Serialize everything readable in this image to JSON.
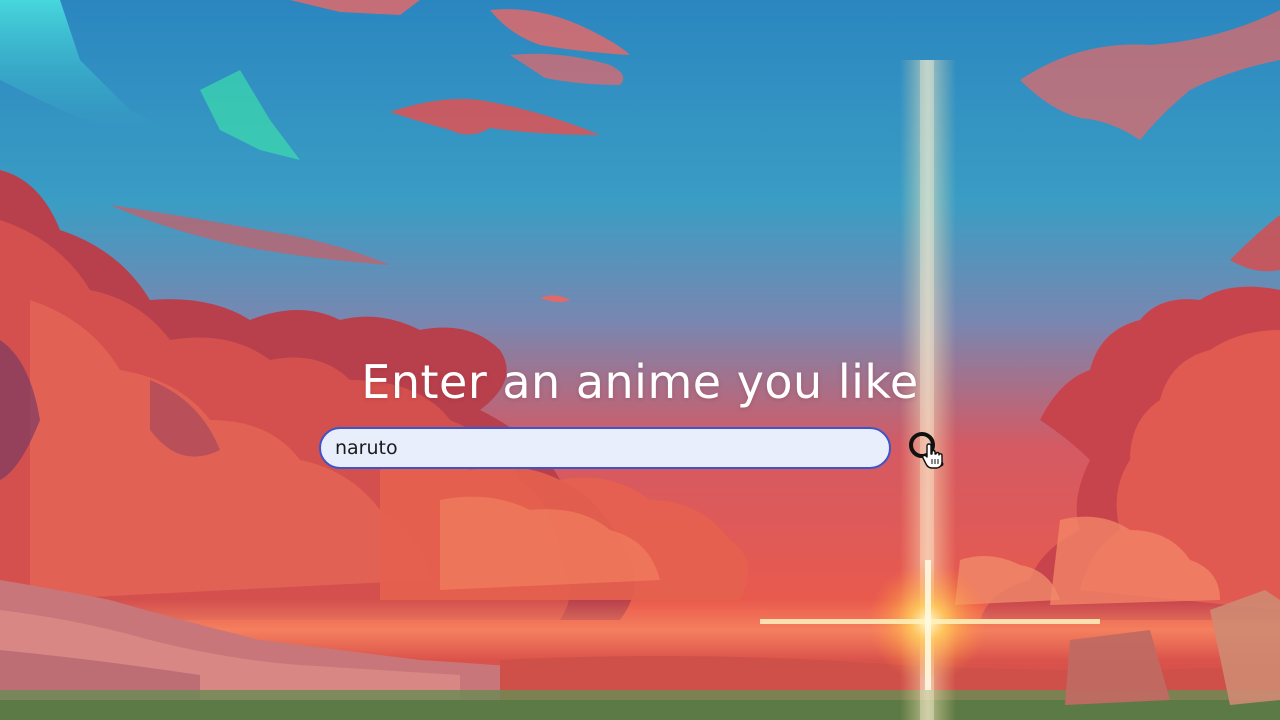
{
  "page": {
    "heading": "Enter an anime you like"
  },
  "search": {
    "value": "naruto",
    "placeholder": ""
  },
  "icons": {
    "search_button": "magnifier-icon",
    "cursor": "hand-pointer-icon"
  },
  "colors": {
    "sky_top": "#2f8fc4",
    "sky_mid": "#4aa6c6",
    "sky_horizon": "#e0504a",
    "cloud": "#e8574f",
    "cloud_dark": "#a8384a",
    "input_background": "#e8eefb",
    "input_border": "#3f54c9",
    "light_beam": "#ffd27a",
    "heading_text": "#ffffff"
  }
}
